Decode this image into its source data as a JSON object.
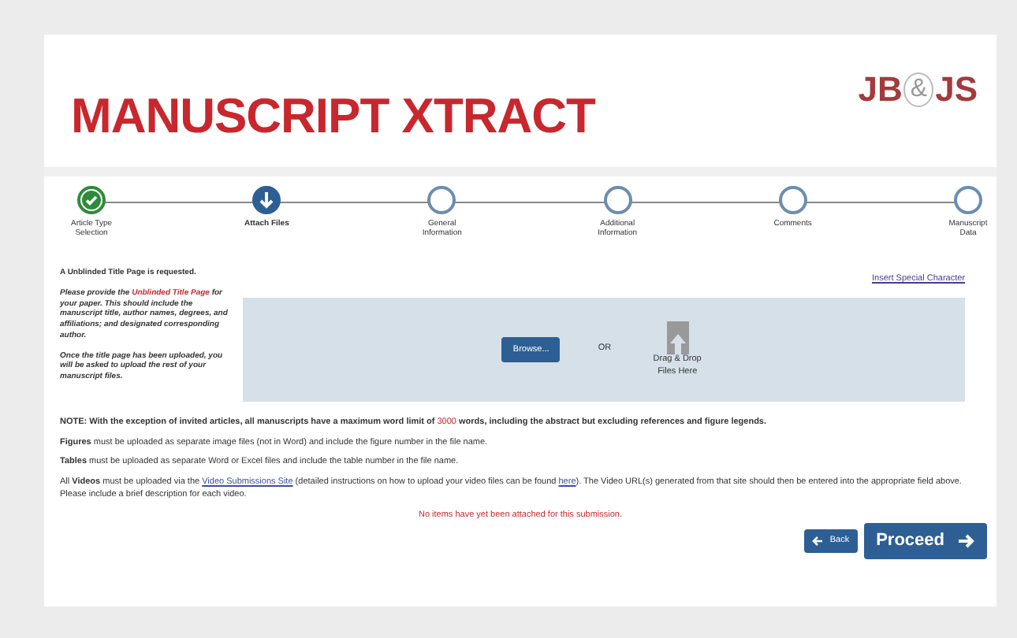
{
  "header": {
    "title": "MANUSCRIPT XTRACT",
    "logo_left": "JB",
    "logo_mid": "&",
    "logo_right": "JS"
  },
  "steps": [
    {
      "label": "Article Type Selection",
      "completed": true,
      "selected": false
    },
    {
      "label": "Attach Files",
      "completed": false,
      "selected": true
    },
    {
      "label": "General Information",
      "completed": false,
      "selected": false
    },
    {
      "label": "Additional Information",
      "completed": false,
      "selected": false
    },
    {
      "label": "Comments",
      "completed": false,
      "selected": false
    },
    {
      "label": "Manuscript Data",
      "completed": false,
      "selected": false
    }
  ],
  "title_page": {
    "heading": "A Unblinded Title Page is requested.",
    "request": {
      "before": "Please provide the ",
      "highlight": "Unblinded Title Page",
      "after": " for your paper. This should include the manuscript title, author names, degrees, and affiliations; and designated corresponding author."
    },
    "followup": "Once the title page has been uploaded, you will be asked to upload the rest of your manuscript files."
  },
  "upload": {
    "special_link": "Insert Special Character",
    "browse_button": "Browse...",
    "or_text": "OR",
    "drop_label": "Drag & Drop Files Here"
  },
  "notes": [
    [
      {
        "kind": "text",
        "text": "NOTE: With the exception of invited articles, all manuscripts have a maximum word limit of "
      },
      {
        "kind": "highlight",
        "text": "3000"
      },
      {
        "kind": "text",
        "text": " words, including the abstract but excluding references and figure legends."
      }
    ],
    [
      {
        "kind": "plain",
        "text": "**Figures** must be uploaded as separate image files (not in Word) and include the figure number in the file name."
      }
    ],
    [
      {
        "kind": "plain",
        "text": "**Tables** must be uploaded as separate Word or Excel files and include the table number in the file name."
      }
    ],
    [
      {
        "kind": "plain",
        "text": "All **Videos** must be uploaded via the "
      },
      {
        "kind": "link",
        "text": "Video Submissions Site"
      },
      {
        "kind": "plain",
        "text": " (detailed instructions on how to upload your video files can be found "
      },
      {
        "kind": "link",
        "text": "here"
      },
      {
        "kind": "plain",
        "text": "). The Video URL(s) generated from that site should then be entered into the appropriate field above. Please include a brief description for each video."
      }
    ]
  ],
  "status_message": "No items have yet been attached for this submission.",
  "buttons": {
    "back": "Back",
    "proceed": "Proceed"
  }
}
